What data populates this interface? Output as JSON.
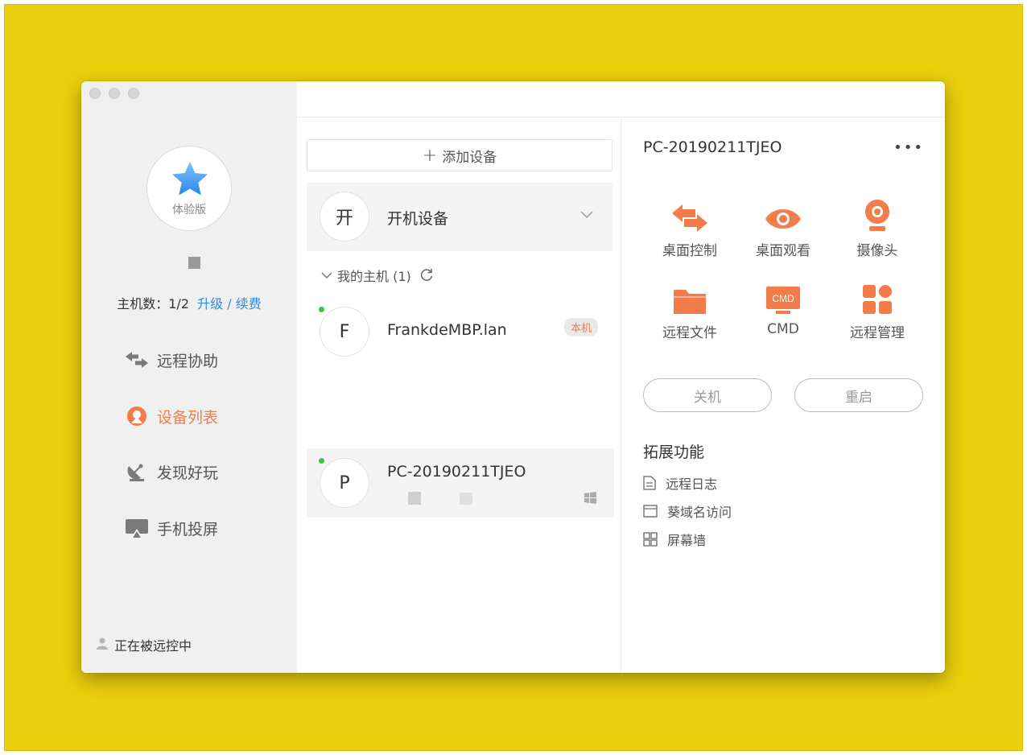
{
  "sidebar": {
    "edition_label": "体验版",
    "host_count_label": "主机数：",
    "host_count_value": "1/2",
    "upgrade_link": "升级 / 续费",
    "nav": [
      {
        "label": "远程协助",
        "icon": "arrows-swap-icon"
      },
      {
        "label": "设备列表",
        "icon": "device-list-icon",
        "active": true
      },
      {
        "label": "发现好玩",
        "icon": "satellite-dish-icon"
      },
      {
        "label": "手机投屏",
        "icon": "screen-cast-icon"
      }
    ],
    "status_text": "正在被远控中"
  },
  "middle": {
    "add_device_label": "添加设备",
    "group": {
      "avatar_char": "开",
      "title": "开机设备"
    },
    "section_label": "我的主机 (1)",
    "devices": [
      {
        "avatar_char": "F",
        "name": "FrankdeMBP.lan",
        "badge": "本机",
        "online": true
      },
      {
        "avatar_char": "P",
        "name": "PC-20190211TJEO",
        "online": true,
        "os_icon": "windows-icon"
      }
    ]
  },
  "detail": {
    "title": "PC-20190211TJEO",
    "more": "•••",
    "actions": [
      {
        "label": "桌面控制",
        "icon": "desktop-control-icon"
      },
      {
        "label": "桌面观看",
        "icon": "eye-icon"
      },
      {
        "label": "摄像头",
        "icon": "camera-icon"
      },
      {
        "label": "远程文件",
        "icon": "folder-icon"
      },
      {
        "label": "CMD",
        "icon": "cmd-icon",
        "icon_text": "CMD"
      },
      {
        "label": "远程管理",
        "icon": "manage-grid-icon"
      }
    ],
    "shutdown_label": "关机",
    "restart_label": "重启",
    "extensions_title": "拓展功能",
    "extensions": [
      {
        "label": "远程日志",
        "icon": "document-icon"
      },
      {
        "label": "葵域名访问",
        "icon": "browser-window-icon"
      },
      {
        "label": "屏幕墙",
        "icon": "grid-icon"
      }
    ]
  },
  "colors": {
    "accent": "#f27c4a",
    "link": "#2a8ce6",
    "online": "#3ec43e",
    "background": "#E9CF0C"
  }
}
